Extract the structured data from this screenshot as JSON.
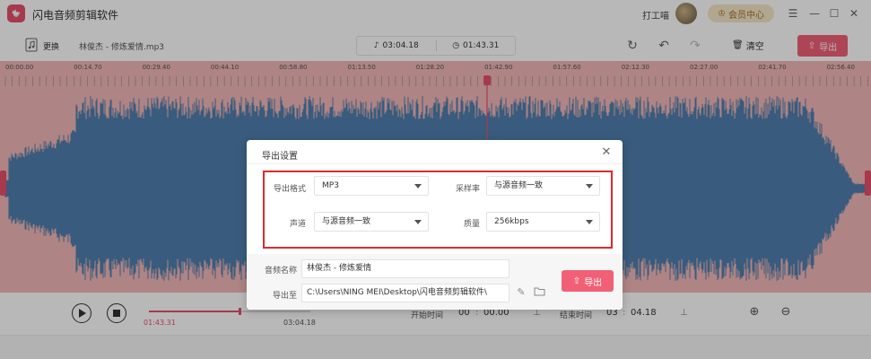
{
  "app": {
    "title": "闪电音频剪辑软件",
    "user_name": "打工喵",
    "member_label": "会员中心"
  },
  "toolbar": {
    "replace_label": "更换",
    "file_name": "林俊杰 - 修炼爱情.mp3",
    "duration": "03:04.18",
    "selected_duration": "01:43.31",
    "clear_label": "清空",
    "export_label": "导出"
  },
  "ruler": {
    "ticks": [
      "00:00.00",
      "00:14.70",
      "00:29.40",
      "00:44.10",
      "00:58.80",
      "01:13.50",
      "01:28.20",
      "01:42.90",
      "01:57.60",
      "02:12.30",
      "02:27.00",
      "02:41.70",
      "02:56.40"
    ]
  },
  "player": {
    "progress_fraction": 0.56,
    "current_time": "01:43.31",
    "total_time": "03:04.18",
    "start_label": "开始时间",
    "start_min": "00",
    "start_sec": "00.00",
    "end_label": "结束时间",
    "end_min": "03",
    "end_sec": "04.18"
  },
  "dialog": {
    "title": "导出设置",
    "format_label": "导出格式",
    "format_value": "MP3",
    "sample_rate_label": "采样率",
    "sample_rate_value": "与源音频一致",
    "channel_label": "声道",
    "channel_value": "与源音频一致",
    "quality_label": "质量",
    "quality_value": "256kbps",
    "name_label": "音频名称",
    "name_value": "林俊杰 - 修炼爱情",
    "path_label": "导出至",
    "path_value": "C:\\Users\\NING MEI\\Desktop\\闪电音频剪辑软件\\",
    "export_label": "导出"
  },
  "colors": {
    "accent": "#f16076",
    "wave": "#4f7fae",
    "wave_bg": "#f3b7b7",
    "highlight": "#e0282c"
  }
}
